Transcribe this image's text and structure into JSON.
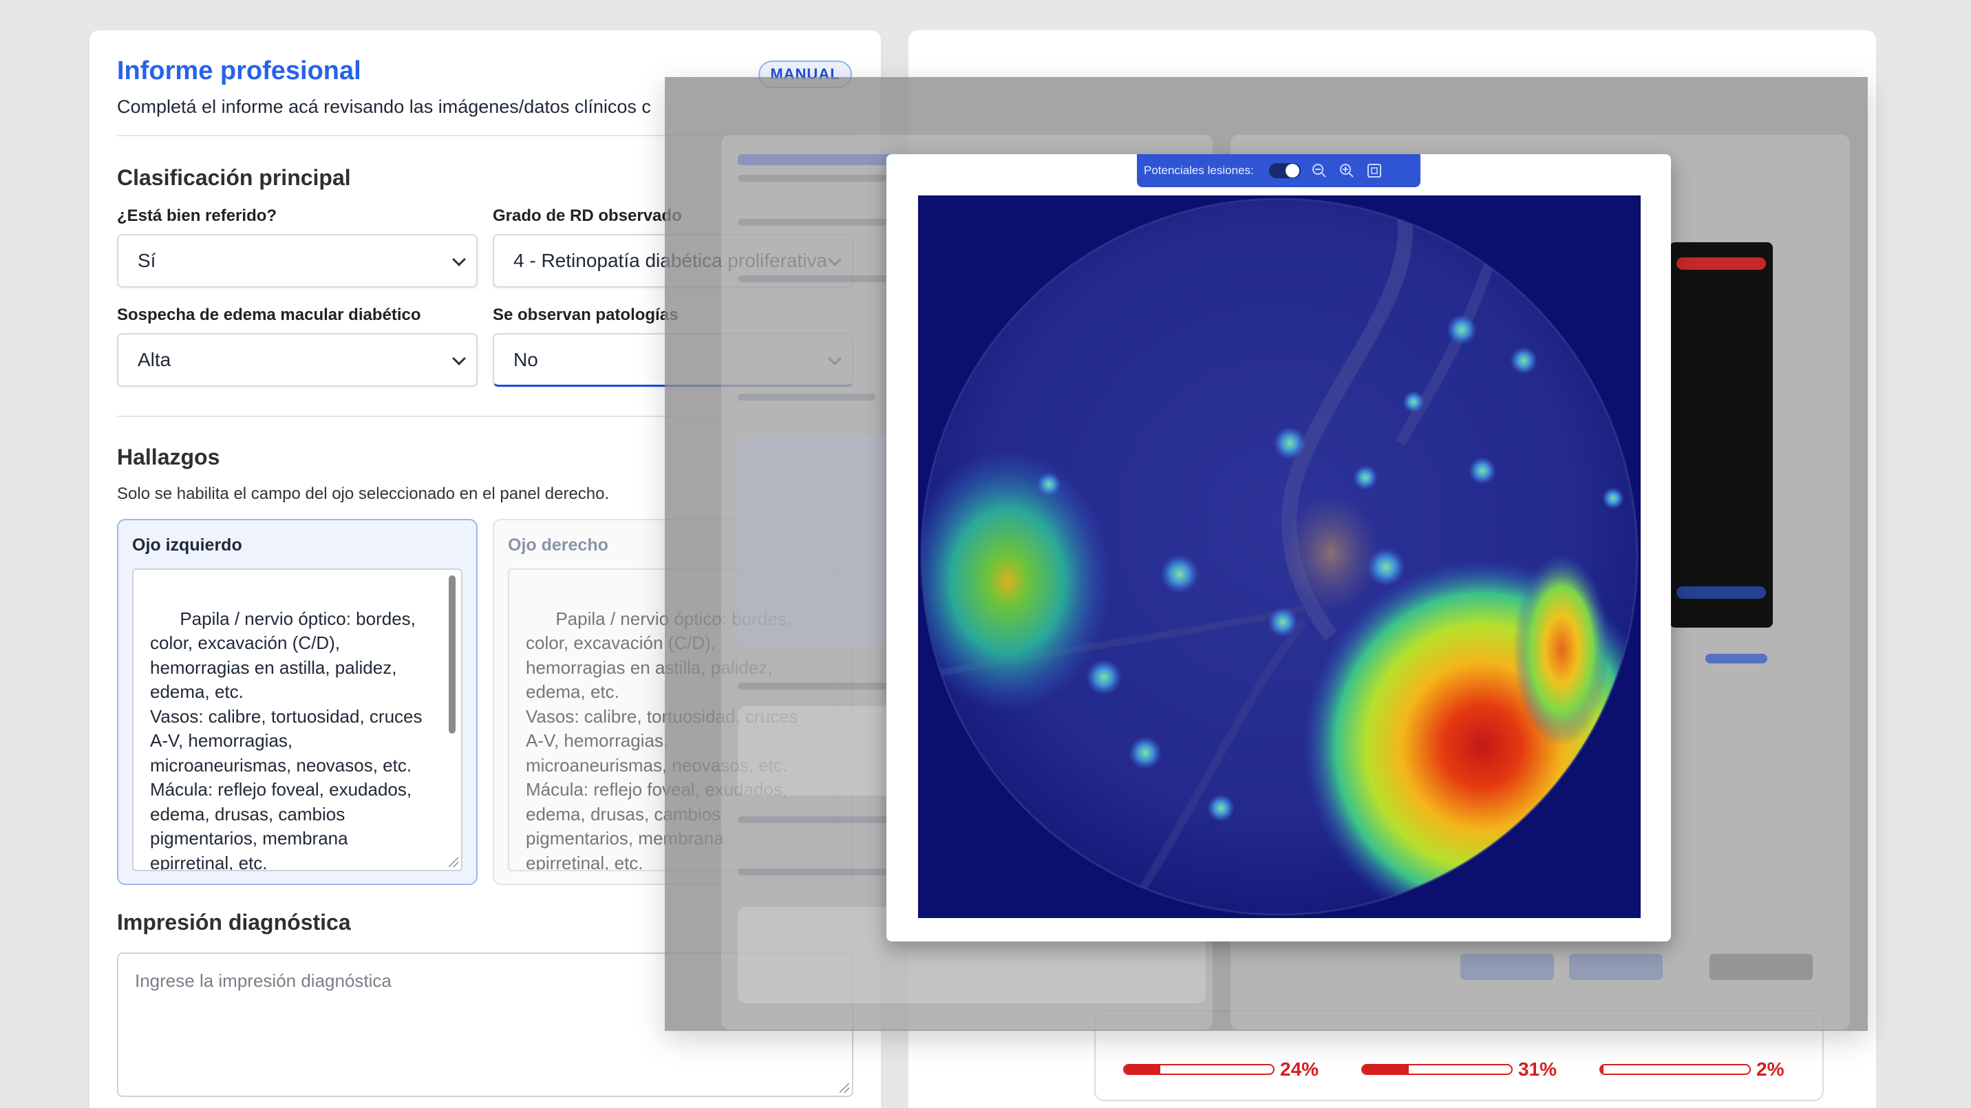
{
  "report": {
    "title": "Informe profesional",
    "badge": "MANUAL",
    "subtitle": "Completá el informe acá revisando las imágenes/datos clínicos c",
    "classification": {
      "section_title": "Clasificación principal",
      "referred_label": "¿Está bien referido?",
      "referred_value": "Sí",
      "grade_label": "Grado de RD observado",
      "grade_value": "4 - Retinopatía diabética proliferativa",
      "edema_label": "Sospecha de edema macular diabético",
      "edema_value": "Alta",
      "pathologies_label": "Se observan patologías",
      "pathologies_value": "No"
    },
    "findings": {
      "section_title": "Hallazgos",
      "helper": "Solo se habilita el campo del ojo seleccionado en el panel derecho.",
      "left_eye_title": "Ojo izquierdo",
      "right_eye_title": "Ojo derecho",
      "left_eye_text": "Papila / nervio óptico: bordes, color, excavación (C/D), hemorragias en astilla, palidez, edema, etc.\nVasos: calibre, tortuosidad, cruces A-V, hemorragias, microaneurismas, neovasos, etc.\nMácula: reflejo foveal, exudados, edema, drusas, cambios pigmentarios, membrana epirretinal, etc.",
      "right_eye_text": "Papila / nervio óptico: bordes, color, excavación (C/D), hemorragias en astilla, palidez, edema, etc.\nVasos: calibre, tortuosidad, cruces A-V, hemorragias, microaneurismas, neovasos, etc.\nMácula: reflejo foveal, exudados, edema, drusas, cambios pigmentarios, membrana epirretinal, etc."
    },
    "impression": {
      "section_title": "Impresión diagnóstica",
      "placeholder": "Ingrese la impresión diagnóstica"
    }
  },
  "probabilities": [
    {
      "value": 0.24,
      "label": "24%"
    },
    {
      "value": 0.31,
      "label": "31%"
    },
    {
      "value": 0.02,
      "label": "2%"
    }
  ],
  "viewer": {
    "toggle_label": "Potenciales lesiones:",
    "toggle_on": true,
    "icons": [
      "zoom-out-icon",
      "zoom-in-icon",
      "fit-screen-icon"
    ]
  },
  "colors": {
    "accent": "#2563eb",
    "probability": "#d61f1f",
    "toolbar": "#2f55d4"
  }
}
